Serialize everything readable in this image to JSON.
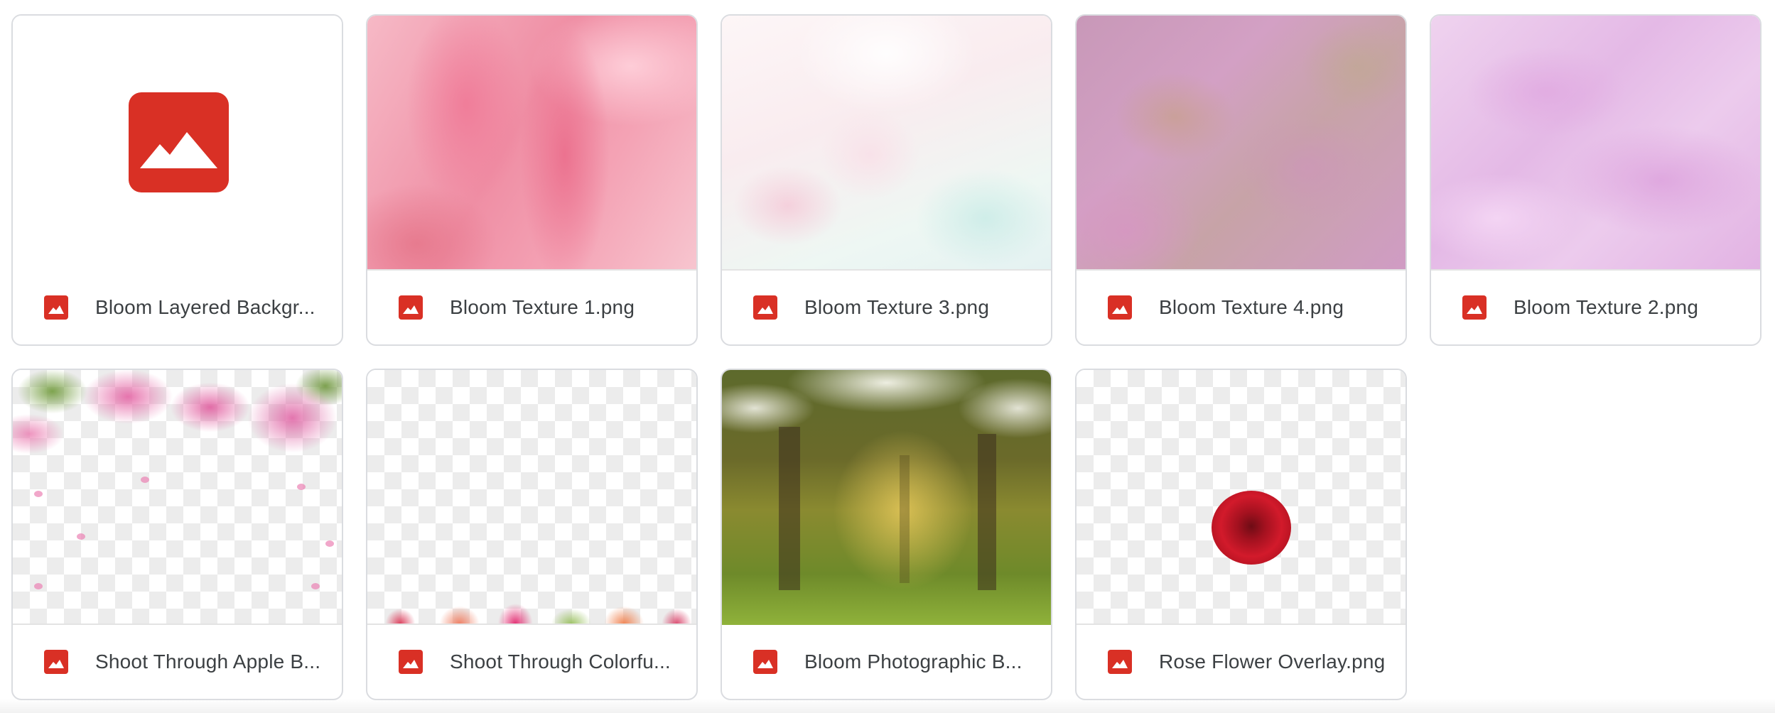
{
  "files": [
    {
      "name": "Bloom Layered Backgr...",
      "thumb": "placeholder",
      "icon": "image-file-icon"
    },
    {
      "name": "Bloom Texture 1.png",
      "thumb": "texture-pink",
      "icon": "image-file-icon"
    },
    {
      "name": "Bloom Texture 3.png",
      "thumb": "texture-pastel",
      "icon": "image-file-icon"
    },
    {
      "name": "Bloom Texture 4.png",
      "thumb": "texture-mauve",
      "icon": "image-file-icon"
    },
    {
      "name": "Bloom Texture 2.png",
      "thumb": "texture-lilac",
      "icon": "image-file-icon"
    },
    {
      "name": "Shoot Through Apple B...",
      "thumb": "apple-blossom-overlay",
      "icon": "image-file-icon"
    },
    {
      "name": "Shoot Through Colorfu...",
      "thumb": "colorful-flowers-overlay",
      "icon": "image-file-icon"
    },
    {
      "name": "Bloom Photographic B...",
      "thumb": "forest-blossom-photo",
      "icon": "image-file-icon"
    },
    {
      "name": "Rose Flower Overlay.png",
      "thumb": "rose-overlay",
      "icon": "image-file-icon"
    }
  ],
  "colors": {
    "icon_red": "#d93025",
    "text": "#3c4043",
    "border": "#dadce0"
  }
}
